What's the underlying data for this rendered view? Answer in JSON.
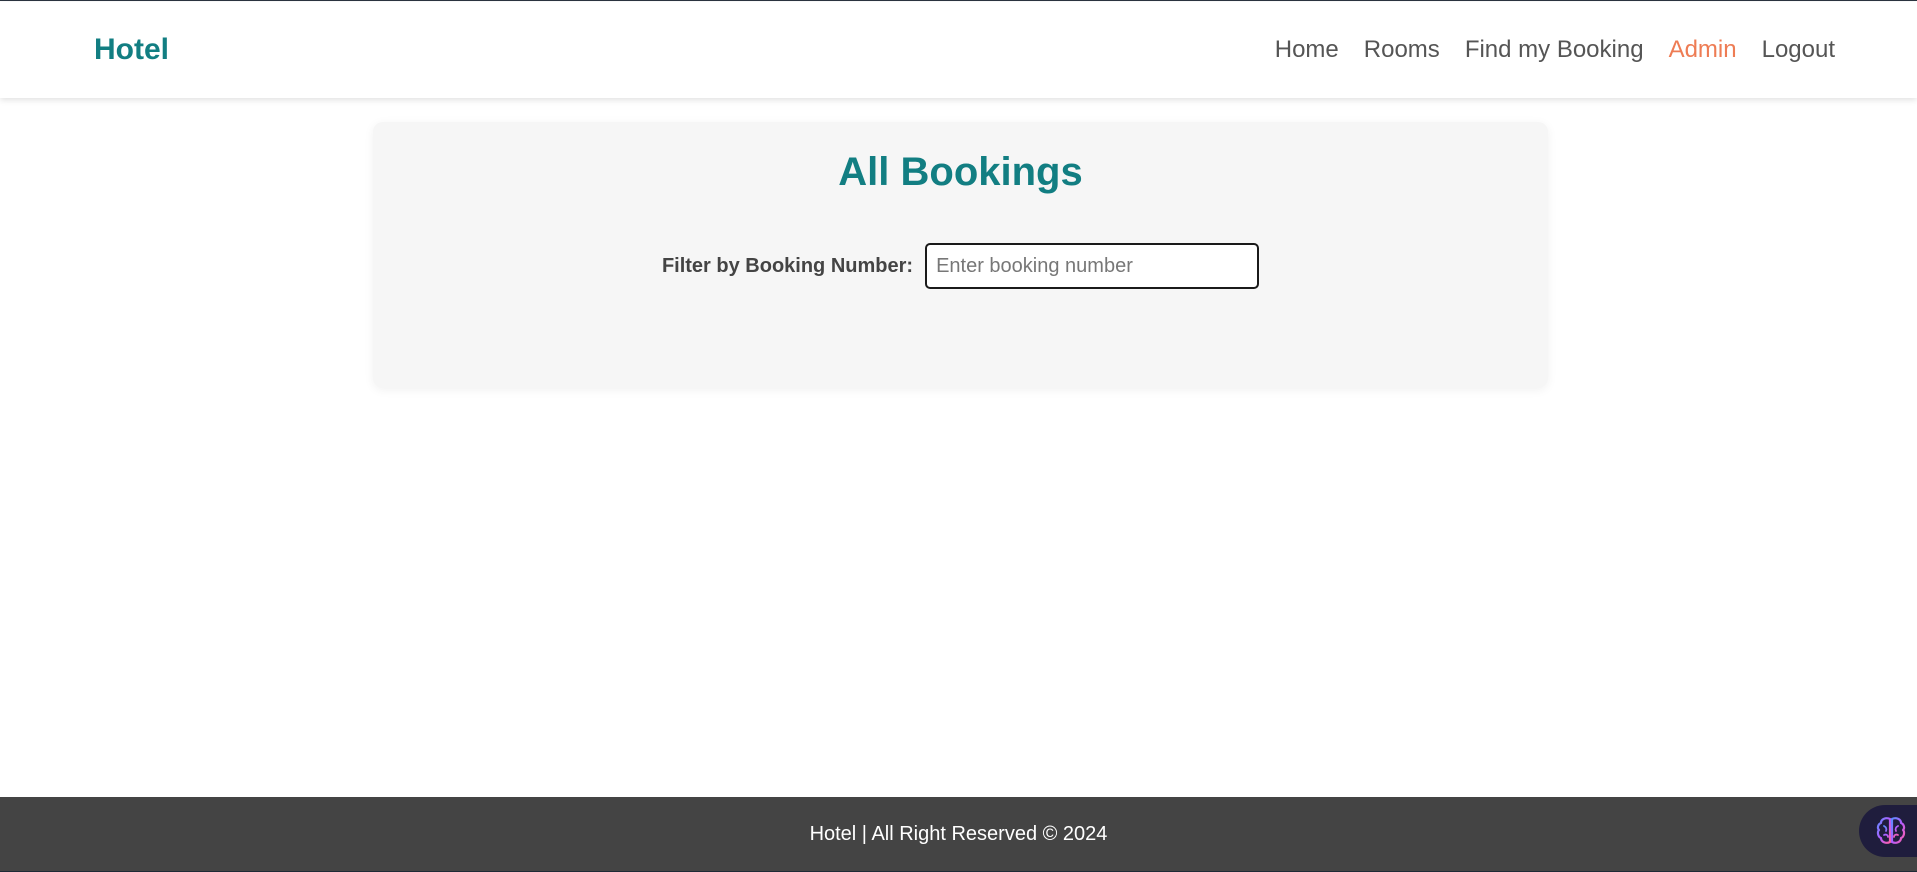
{
  "header": {
    "brand": "Hotel",
    "nav": {
      "home": "Home",
      "rooms": "Rooms",
      "find_booking": "Find my Booking",
      "admin": "Admin",
      "logout": "Logout"
    }
  },
  "main": {
    "title": "All Bookings",
    "filter": {
      "label": "Filter by Booking Number:",
      "value": "",
      "placeholder": "Enter booking number"
    }
  },
  "footer": {
    "text": "Hotel | All Right Reserved © 2024"
  },
  "icons": {
    "assistant": "brain-icon"
  },
  "colors": {
    "brand": "#127e82",
    "active_nav": "#ee7c54",
    "nav_text": "#555555",
    "footer_bg": "#444444",
    "card_bg": "#f6f6f6"
  }
}
